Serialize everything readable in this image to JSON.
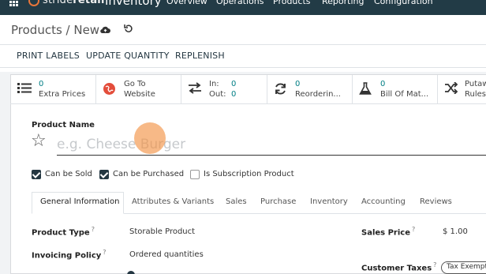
{
  "navbar": {
    "logo_text": "stride",
    "logo_text_strong": "retail",
    "app_name": "Inventory",
    "menu": [
      "Overview",
      "Operations",
      "Products",
      "Reporting",
      "Configuration"
    ]
  },
  "breadcrumb": {
    "text": "Products / New",
    "cloud_icon": "cloud-upload-icon",
    "discard_icon": "undo-icon"
  },
  "actions": [
    "PRINT LABELS",
    "UPDATE QUANTITY",
    "REPLENISH"
  ],
  "smart_buttons": [
    {
      "icon": "list-icon",
      "value": "0",
      "label": "Extra Prices"
    },
    {
      "icon": "globe-icon",
      "value": "Go To",
      "label": "Website"
    },
    {
      "icon": "transfer-arrows-icon",
      "in_label": "In:",
      "in_value": "0",
      "out_label": "Out:",
      "out_value": "0"
    },
    {
      "icon": "refresh-icon",
      "value": "0",
      "label": "Reorderin..."
    },
    {
      "icon": "flask-icon",
      "value": "0",
      "label": "Bill Of Mat..."
    },
    {
      "icon": "shuffle-icon",
      "value": "Putaw",
      "label": "Rules"
    }
  ],
  "form": {
    "product_name_label": "Product Name",
    "product_name_placeholder": "e.g. Cheese Burger",
    "product_name_value": "",
    "checkboxes": [
      {
        "label": "Can be Sold",
        "checked": true
      },
      {
        "label": "Can be Purchased",
        "checked": true
      },
      {
        "label": "Is Subscription Product",
        "checked": false
      }
    ]
  },
  "tabs": [
    "General Information",
    "Attributes & Variants",
    "Sales",
    "Purchase",
    "Inventory",
    "Accounting",
    "Reviews"
  ],
  "active_tab": "General Information",
  "fields": {
    "product_type_label": "Product Type",
    "product_type_value": "Storable Product",
    "invoicing_policy_label": "Invoicing Policy",
    "invoicing_policy_value": "Ordered quantities",
    "sales_price_label": "Sales Price",
    "sales_price_value": "$ 1.00",
    "customer_taxes_label": "Customer Taxes",
    "customer_taxes_value": "Tax Exempt",
    "help_mark": "?"
  },
  "colors": {
    "navbar": "#223b46",
    "accent_teal": "#017e84",
    "checkbox": "#243742",
    "cursor": "#f29446"
  }
}
